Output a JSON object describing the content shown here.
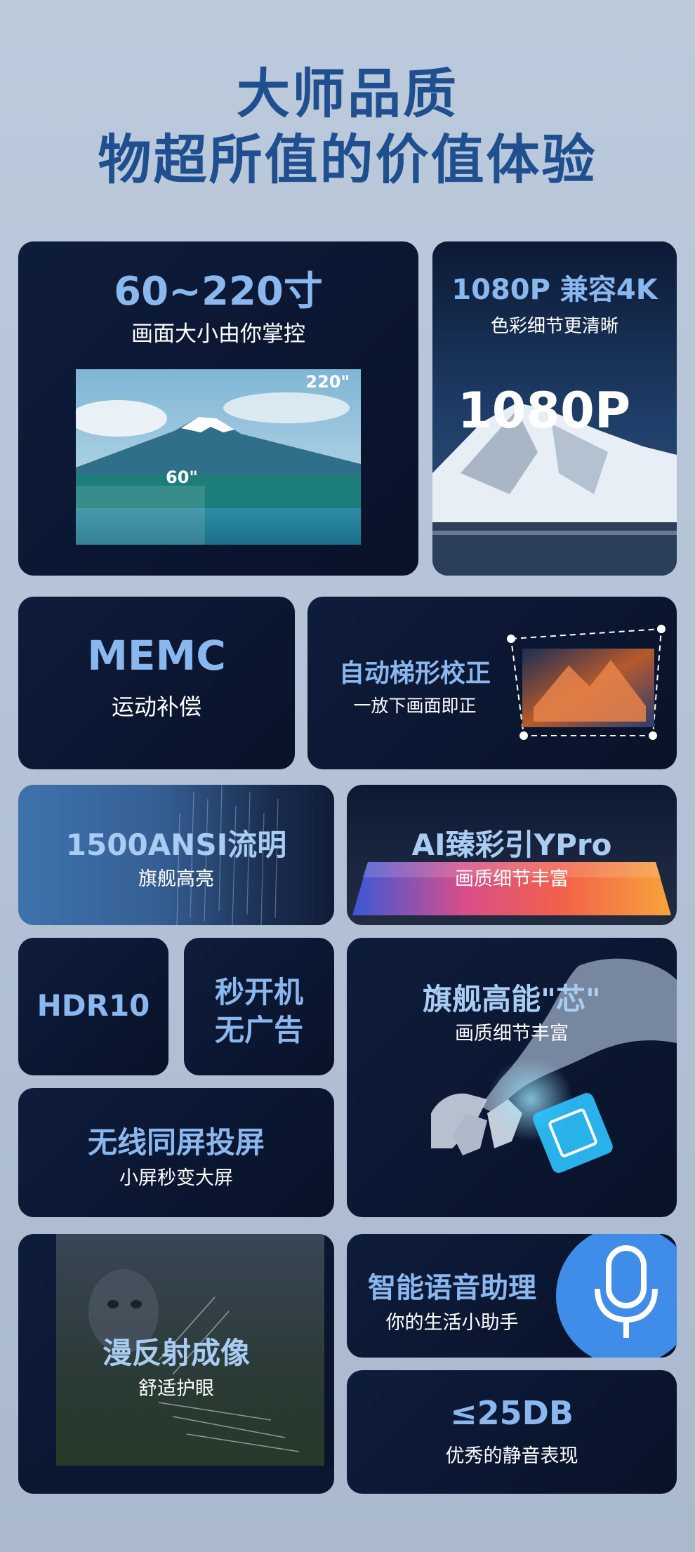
{
  "header": {
    "line1": "大师品质",
    "line2": "物超所值的价值体验"
  },
  "features": {
    "screen_size": {
      "title": "60~220寸",
      "subtitle": "画面大小由你掌控",
      "label_large": "220\"",
      "label_small": "60\""
    },
    "resolution": {
      "title": "1080P 兼容4K",
      "subtitle": "色彩细节更清晰",
      "overlay": "1080P"
    },
    "memc": {
      "title": "MEMC",
      "subtitle": "运动补偿"
    },
    "keystone": {
      "title": "自动梯形校正",
      "subtitle": "一放下画面即正"
    },
    "brightness": {
      "title": "1500ANSI流明",
      "subtitle": "旗舰高亮"
    },
    "ai_engine": {
      "title": "AI臻彩引YPro",
      "subtitle": "画质细节丰富"
    },
    "hdr": {
      "title": "HDR10"
    },
    "boot": {
      "line1": "秒开机",
      "line2": "无广告"
    },
    "chip": {
      "title": "旗舰高能\"芯\"",
      "subtitle": "画质细节丰富"
    },
    "casting": {
      "title": "无线同屏投屏",
      "subtitle": "小屏秒变大屏"
    },
    "diffuse": {
      "title": "漫反射成像",
      "subtitle": "舒适护眼"
    },
    "voice": {
      "title": "智能语音助理",
      "subtitle": "你的生活小助手"
    },
    "noise": {
      "title": "≤25DB",
      "subtitle": "优秀的静音表现"
    }
  },
  "colors": {
    "headline": "#1f4f8f",
    "card_bg": "#0c1935",
    "accent_title": "#8ab8ee",
    "subtitle": "#ffffff",
    "voice_badge": "#3f8de8"
  }
}
